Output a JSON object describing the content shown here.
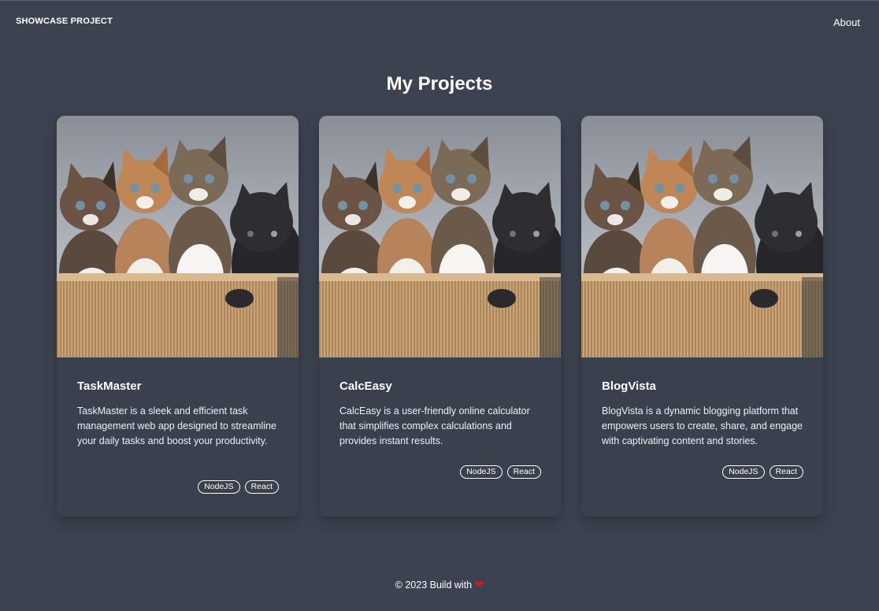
{
  "nav": {
    "brand": "SHOWCASE PROJECT",
    "about": "About"
  },
  "page": {
    "title": "My Projects"
  },
  "projects": [
    {
      "title": "TaskMaster",
      "description": "TaskMaster is a sleek and efficient task management web app designed to streamline your daily tasks and boost your productivity.",
      "tags": [
        "NodeJS",
        "React"
      ]
    },
    {
      "title": "CalcEasy",
      "description": "CalcEasy is a user-friendly online calculator that simplifies complex calculations and provides instant results.",
      "tags": [
        "NodeJS",
        "React"
      ]
    },
    {
      "title": "BlogVista",
      "description": "BlogVista is a dynamic blogging platform that empowers users to create, share, and engage with captivating content and stories.",
      "tags": [
        "NodeJS",
        "React"
      ]
    }
  ],
  "footer": {
    "text": "© 2023 Build with",
    "icon": "heart-icon"
  },
  "colors": {
    "background": "#3c4350",
    "card": "#3a414e",
    "heart": "#e0141b"
  }
}
